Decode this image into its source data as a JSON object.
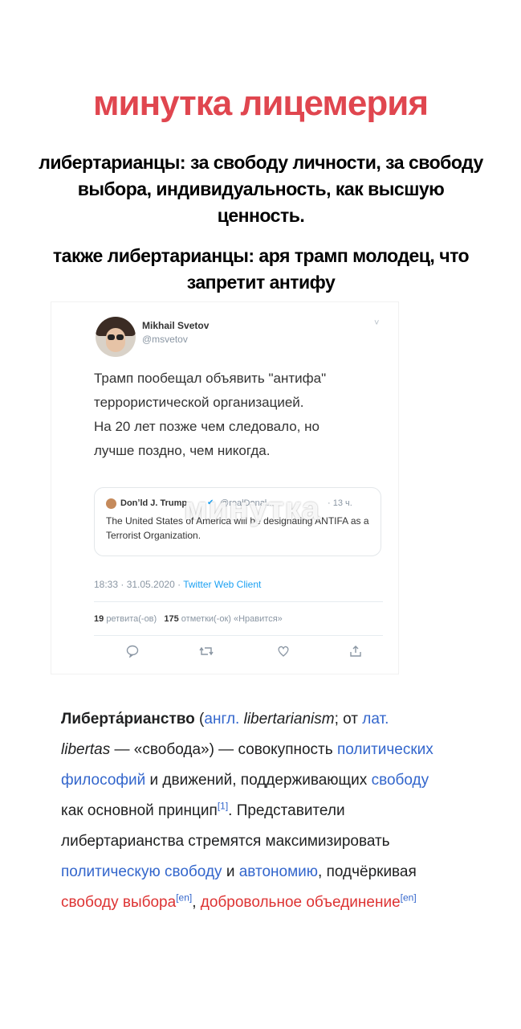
{
  "headline": "минутка лицемерия",
  "caption1": "либертарианцы: за свободу личности, за свободу выбора, индивидуальность, как высшую ценность.",
  "caption2": "также либертарианцы: аря трамп молодец, что запретит антифу",
  "tweet": {
    "author": "Mikhail Svetov",
    "handle": "@msvetov",
    "chevron": "˅",
    "lines": [
      "Трамп пообещал объявить \"антифа\"",
      "террористической организацией.",
      "На 20 лет позже чем следовало, но",
      "лучше поздно, чем никогда."
    ],
    "quote": {
      "author": "Donʼld J. Trump",
      "verified": "✔",
      "handle": "@realDonal...",
      "time": "· 13 ч.",
      "text": "The United States of America will be designating ANTIFA as a Terrorist Organization."
    },
    "watermark": "минутка",
    "time": "18:33 · 31.05.2020 ·",
    "client": "Twitter Web Client",
    "retweets": "19",
    "retweets_label": "ретвита(-ов)",
    "likes": "175",
    "likes_label": "отметки(-ок) «Нравится»",
    "actions": [
      "♡",
      "⇄",
      "♡",
      "⇪"
    ]
  },
  "wiki": {
    "term": "Либерта́рианство",
    "p_open": " (",
    "engl_abbr": "англ.",
    "engl_word": " libertarianism",
    "mid1": "; от ",
    "lat_abbr": "лат.",
    "lat_word": " libertas",
    "mid2": " — «свобода») — совокупность ",
    "link_phil": "политических философий",
    "mid3": " и движений, поддерживающих ",
    "link_free": "свободу",
    "mid4": " как основной принцип",
    "ref1": "[1]",
    "mid5": ". Представители либертарианства стремятся максимизировать ",
    "link_polfree": "политическую свободу",
    "mid6": " и ",
    "link_auto": "автономию",
    "mid7": ", подчёркивая ",
    "link_choice": "свободу выбора",
    "ref_en1": "[en]",
    "mid8": ", ",
    "link_assoc": "добровольное объединение",
    "ref_en2": "[en]"
  }
}
